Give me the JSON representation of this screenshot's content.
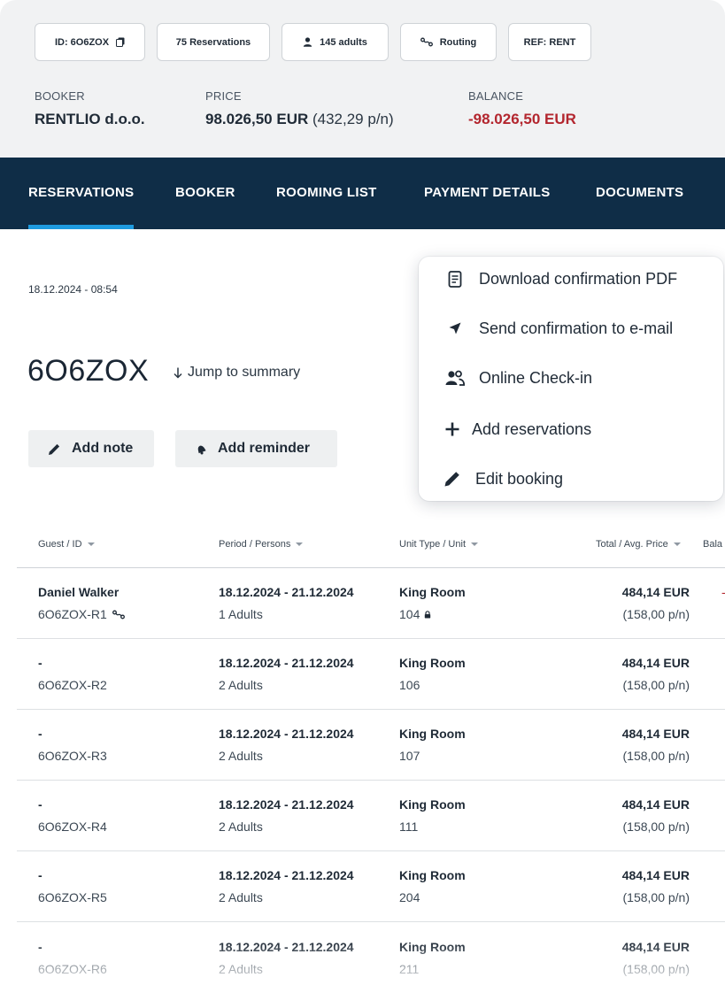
{
  "header": {
    "chips": {
      "id": "ID: 6O6ZOX",
      "reservations": "75 Reservations",
      "adults": "145 adults",
      "routing": "Routing",
      "ref": "REF: RENT"
    },
    "booker": {
      "label": "BOOKER",
      "value": "RENTLIO d.o.o."
    },
    "price": {
      "label": "PRICE",
      "value": "98.026,50 EUR",
      "per_night": "(432,29 p/n)"
    },
    "balance": {
      "label": "BALANCE",
      "value": "-98.026,50 EUR"
    }
  },
  "nav": {
    "tabs": [
      "RESERVATIONS",
      "BOOKER",
      "ROOMING LIST",
      "PAYMENT DETAILS",
      "DOCUMENTS"
    ],
    "active": "RESERVATIONS"
  },
  "booking": {
    "date": "18.12.2024 - 08:54",
    "code": "6O6ZOX",
    "jump_label": "Jump to summary",
    "add_note": "Add note",
    "add_reminder": "Add reminder"
  },
  "menu": {
    "items": [
      {
        "label": "Download confirmation PDF",
        "icon": "document-icon"
      },
      {
        "label": "Send confirmation to e-mail",
        "icon": "send-icon"
      },
      {
        "label": "Online Check-in",
        "icon": "users-icon"
      },
      {
        "label": "Add reservations",
        "icon": "plus-icon"
      },
      {
        "label": "Edit booking",
        "icon": "pencil-icon"
      }
    ]
  },
  "table": {
    "columns": [
      "Guest / ID",
      "Period / Persons",
      "Unit Type / Unit",
      "Total / Avg. Price",
      "Bala"
    ],
    "rows": [
      {
        "guest": "Daniel Walker",
        "id": "6O6ZOX-R1",
        "period": "18.12.2024 - 21.12.2024",
        "persons": "1 Adults",
        "unit_type": "King Room",
        "unit": "104",
        "total": "484,14 EUR",
        "avg": "(158,00 p/n)"
      },
      {
        "guest": "-",
        "id": "6O6ZOX-R2",
        "period": "18.12.2024 - 21.12.2024",
        "persons": "2 Adults",
        "unit_type": "King Room",
        "unit": "106",
        "total": "484,14 EUR",
        "avg": "(158,00 p/n)"
      },
      {
        "guest": "-",
        "id": "6O6ZOX-R3",
        "period": "18.12.2024 - 21.12.2024",
        "persons": "2 Adults",
        "unit_type": "King Room",
        "unit": "107",
        "total": "484,14 EUR",
        "avg": "(158,00 p/n)"
      },
      {
        "guest": "-",
        "id": "6O6ZOX-R4",
        "period": "18.12.2024 - 21.12.2024",
        "persons": "2 Adults",
        "unit_type": "King Room",
        "unit": "111",
        "total": "484,14 EUR",
        "avg": "(158,00 p/n)"
      },
      {
        "guest": "-",
        "id": "6O6ZOX-R5",
        "period": "18.12.2024 - 21.12.2024",
        "persons": "2 Adults",
        "unit_type": "King Room",
        "unit": "204",
        "total": "484,14 EUR",
        "avg": "(158,00 p/n)"
      },
      {
        "guest": "-",
        "id": "6O6ZOX-R6",
        "period": "18.12.2024 - 21.12.2024",
        "persons": "2 Adults",
        "unit_type": "King Room",
        "unit": "211",
        "total": "484,14 EUR",
        "avg": "(158,00 p/n)"
      }
    ],
    "first_row_balance_mark": "-"
  },
  "colors": {
    "nav_bg": "#0f2d47",
    "nav_active": "#1e9be0",
    "negative": "#b3262e",
    "header_bg": "#f1f2f3"
  }
}
